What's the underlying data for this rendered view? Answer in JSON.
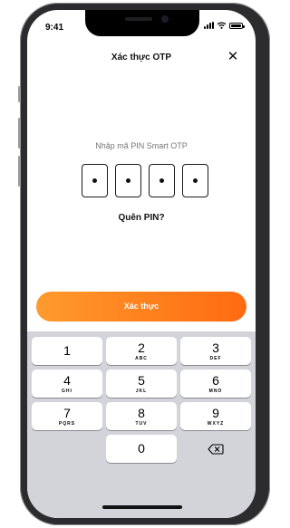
{
  "status_bar": {
    "time": "9:41"
  },
  "header": {
    "title": "Xác thực OTP",
    "close_glyph": "✕"
  },
  "pin": {
    "label": "Nhập mã PIN Smart OTP",
    "digits_entered": 4,
    "digits_total": 4
  },
  "forgot_pin": "Quên PIN?",
  "verify_button": {
    "label": "Xác thực",
    "gradient_start": "#ff9a2e",
    "gradient_end": "#ff6a10"
  },
  "keypad": {
    "keys": [
      {
        "digit": "1",
        "letters": ""
      },
      {
        "digit": "2",
        "letters": "ABC"
      },
      {
        "digit": "3",
        "letters": "DEF"
      },
      {
        "digit": "4",
        "letters": "GHI"
      },
      {
        "digit": "5",
        "letters": "JKL"
      },
      {
        "digit": "6",
        "letters": "MNO"
      },
      {
        "digit": "7",
        "letters": "PQRS"
      },
      {
        "digit": "8",
        "letters": "TUV"
      },
      {
        "digit": "9",
        "letters": "WXYZ"
      },
      {
        "digit": "0",
        "letters": ""
      }
    ],
    "delete_icon": "backspace-icon"
  },
  "colors": {
    "accent": "#ff7a1a",
    "keypad_bg": "#d3d4d9"
  }
}
